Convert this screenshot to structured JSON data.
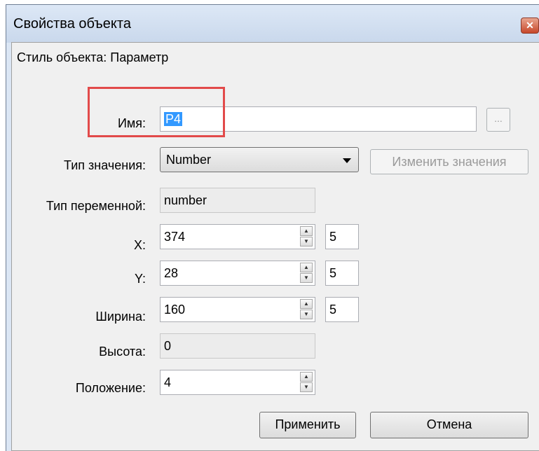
{
  "window": {
    "title": "Свойства объекта"
  },
  "style_line": "Стиль объекта: Параметр",
  "name": {
    "label": "Имя:",
    "value": "P4",
    "browse_label": "..."
  },
  "value_type": {
    "label": "Тип значения:",
    "selected": "Number",
    "change_button": "Изменить значения"
  },
  "variable_type": {
    "label": "Тип переменной:",
    "value": "number"
  },
  "x": {
    "label": "X:",
    "value": "374",
    "step": "5"
  },
  "y": {
    "label": "Y:",
    "value": "28",
    "step": "5"
  },
  "width": {
    "label": "Ширина:",
    "value": "160",
    "step": "5"
  },
  "height": {
    "label": "Высота:",
    "value": "0"
  },
  "position": {
    "label": "Положение:",
    "value": "4"
  },
  "buttons": {
    "apply": "Применить",
    "cancel": "Отмена"
  },
  "colors": {
    "highlight": "#e24a4a",
    "selection": "#3399ff",
    "client_bg": "#f0f0f0"
  }
}
